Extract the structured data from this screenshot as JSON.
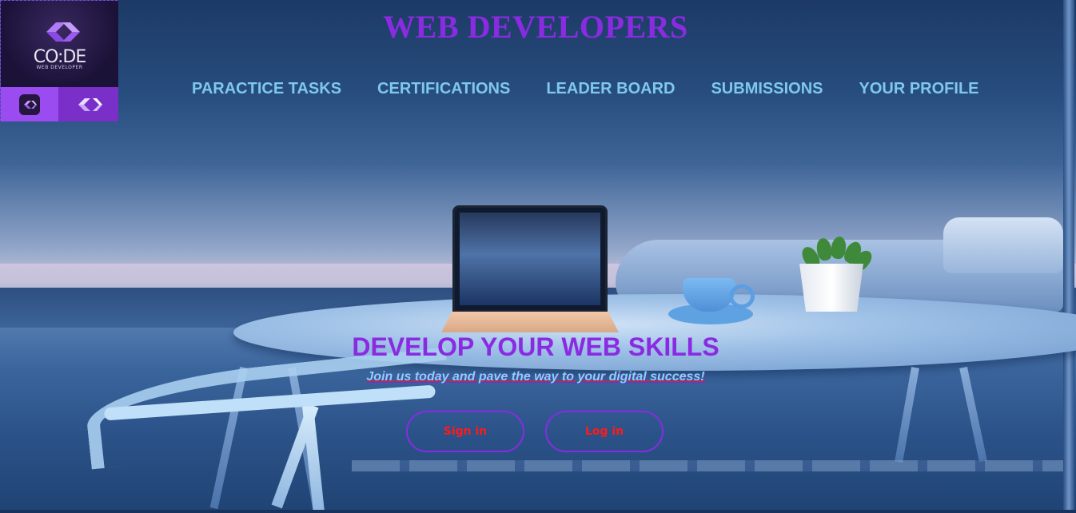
{
  "logo": {
    "text": "CO:DE",
    "subtext": "WEB DEVELOPER",
    "icon": "code-brackets-icon"
  },
  "header": {
    "title": "WEB DEVELOPERS"
  },
  "nav": {
    "items": [
      {
        "label": "PARACTICE TASKS"
      },
      {
        "label": "CERTIFICATIONS"
      },
      {
        "label": "LEADER BOARD"
      },
      {
        "label": "SUBMISSIONS"
      },
      {
        "label": "YOUR PROFILE"
      }
    ]
  },
  "hero": {
    "title": "DEVELOP YOUR WEB SKILLS",
    "subtitle": "Join us today and pave the way to your digital success!",
    "signin_label": "Sign in",
    "login_label": "Log in"
  },
  "colors": {
    "accent": "#8a2be2",
    "nav_text": "#7ec8ec",
    "button_text": "#ff1a1a"
  }
}
